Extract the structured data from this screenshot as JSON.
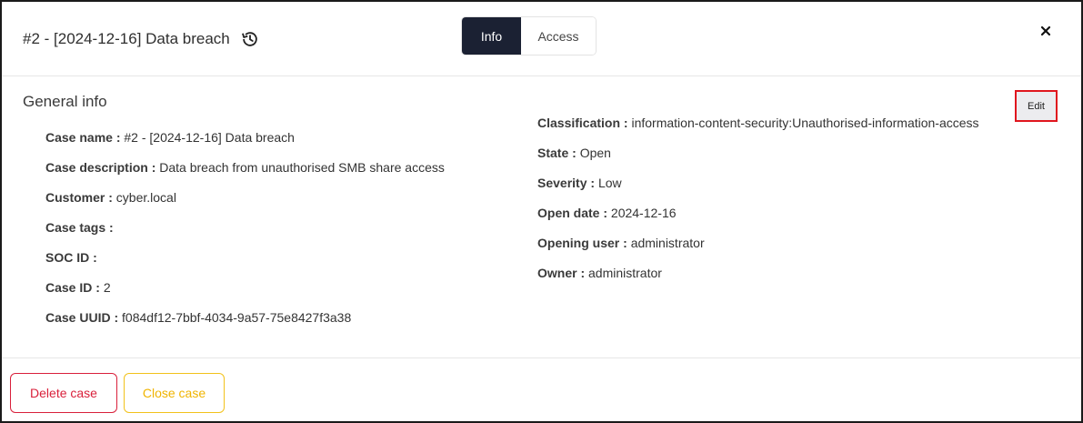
{
  "header": {
    "title": "#2 - [2024-12-16] Data breach",
    "tabs": [
      {
        "label": "Info",
        "active": true
      },
      {
        "label": "Access",
        "active": false
      }
    ]
  },
  "general": {
    "section_title": "General info",
    "edit_label": "Edit",
    "left": [
      {
        "label": "Case name :",
        "value": "#2 - [2024-12-16] Data breach"
      },
      {
        "label": "Case description :",
        "value": "Data breach from unauthorised SMB share access"
      },
      {
        "label": "Customer :",
        "value": "cyber.local"
      },
      {
        "label": "Case tags :",
        "value": ""
      },
      {
        "label": "SOC ID :",
        "value": ""
      },
      {
        "label": "Case ID :",
        "value": "2"
      },
      {
        "label": "Case UUID :",
        "value": "f084df12-7bbf-4034-9a57-75e8427f3a38"
      }
    ],
    "right": [
      {
        "label": "Classification :",
        "value": "information-content-security:Unauthorised-information-access"
      },
      {
        "label": "State :",
        "value": "Open"
      },
      {
        "label": "Severity :",
        "value": "Low"
      },
      {
        "label": "Open date :",
        "value": "2024-12-16"
      },
      {
        "label": "Opening user :",
        "value": "administrator"
      },
      {
        "label": "Owner :",
        "value": "administrator"
      }
    ]
  },
  "footer": {
    "delete_label": "Delete case",
    "close_label": "Close case"
  },
  "icons": {
    "history": "history-icon",
    "close": "close-icon"
  },
  "colors": {
    "active_tab": "#1b2133",
    "delete": "#d9203b",
    "close": "#f0b400",
    "edit_highlight": "#e0161e"
  }
}
